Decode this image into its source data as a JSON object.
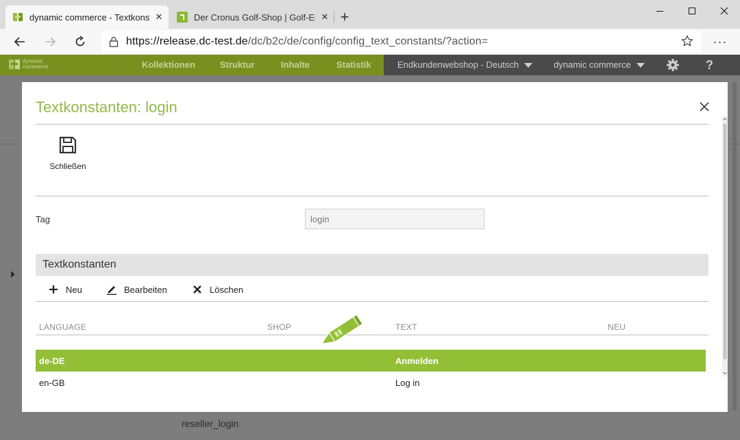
{
  "browser": {
    "tabs": [
      {
        "title": "dynamic commerce - Textkonstanten",
        "active": true
      },
      {
        "title": "Der Cronus Golf-Shop | Golf-Equipment",
        "active": false
      }
    ],
    "new_tab_glyph": "+",
    "url_domain": "https://release.dc-test.de",
    "url_path": "/dc/b2c/de/config/config_text_constants/?action=",
    "window_controls": [
      "minimize",
      "maximize",
      "close"
    ],
    "more_glyph": "···"
  },
  "app_header": {
    "logo_line1": "dynamic",
    "logo_line2": "commerce",
    "nav": [
      "Kollektionen",
      "Struktur",
      "Inhalte",
      "Statistik"
    ],
    "shop_select": "Endkundenwebshop - Deutsch",
    "company_select": "dynamic commerce",
    "help_glyph": "?"
  },
  "background": {
    "list_item": "reseller_login"
  },
  "modal": {
    "title": "Textkonstanten: login",
    "save_label": "Schließen",
    "tag_label": "Tag",
    "tag_value": "login",
    "section_title": "Textkonstanten",
    "toolbar": {
      "new_label": "Neu",
      "edit_label": "Bearbeiten",
      "delete_label": "Löschen"
    },
    "table": {
      "headers": [
        "LANGUAGE",
        "SHOP",
        "TEXT",
        "NEU"
      ],
      "rows": [
        {
          "language": "de-DE",
          "text": "Anmelden",
          "selected": true
        },
        {
          "language": "en-GB",
          "text": "Log in",
          "selected": false
        }
      ]
    }
  },
  "colors": {
    "accent_green": "#93bf37",
    "title_green": "#93b84a",
    "header_green": "#79901f"
  }
}
